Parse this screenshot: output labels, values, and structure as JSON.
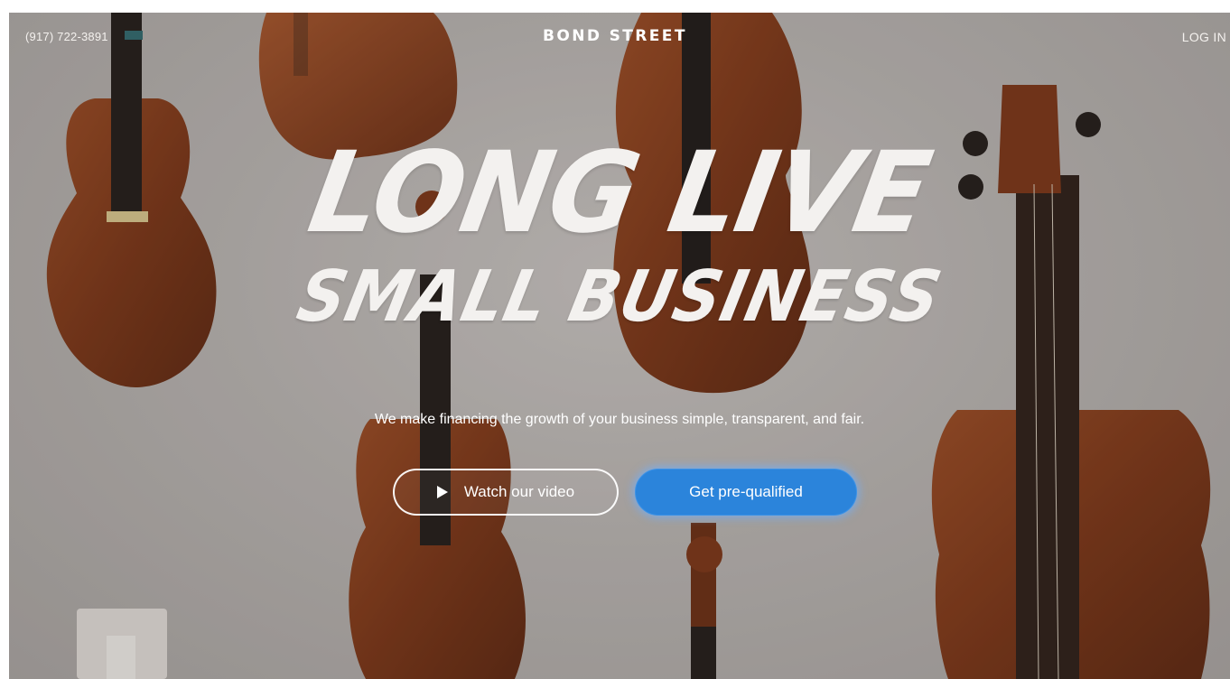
{
  "header": {
    "phone": "(917) 722-3891",
    "brand": "BOND STREET",
    "login_label": "LOG IN"
  },
  "hero": {
    "headline_line1": "LONG LIVE",
    "headline_line2": "SMALL BUSINESS",
    "subtitle": "We make financing the growth of your business simple, transparent, and fair."
  },
  "actions": {
    "watch_video_label": "Watch our video",
    "watch_video_icon": "play-icon",
    "prequalify_label": "Get pre-qualified"
  },
  "colors": {
    "primary_button": "#2b84db",
    "text": "#ffffff"
  }
}
